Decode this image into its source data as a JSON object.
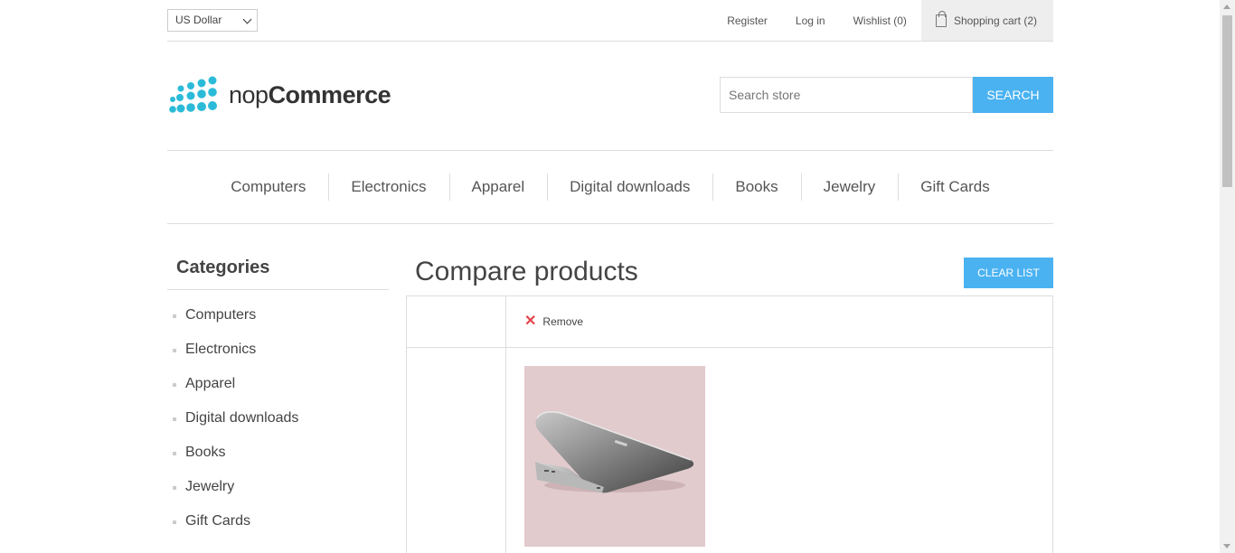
{
  "header": {
    "currency": "US Dollar",
    "links": {
      "register": "Register",
      "login": "Log in",
      "wishlist": "Wishlist (0)",
      "cart": "Shopping cart (2)"
    },
    "logo": {
      "prefix": "nop",
      "suffix": "Commerce"
    },
    "search": {
      "placeholder": "Search store",
      "button": "Search"
    }
  },
  "menu": [
    "Computers",
    "Electronics",
    "Apparel",
    "Digital downloads",
    "Books",
    "Jewelry",
    "Gift Cards"
  ],
  "sidebar": {
    "title": "Categories",
    "items": [
      "Computers",
      "Electronics",
      "Apparel",
      "Digital downloads",
      "Books",
      "Jewelry",
      "Gift Cards"
    ]
  },
  "main": {
    "title": "Compare products",
    "clear_button": "Clear list",
    "remove_label": "Remove",
    "remove_icon": "close-icon"
  },
  "colors": {
    "accent": "#4ab2f1",
    "remove": "#e4434b",
    "logo": "#2bbbd8"
  }
}
